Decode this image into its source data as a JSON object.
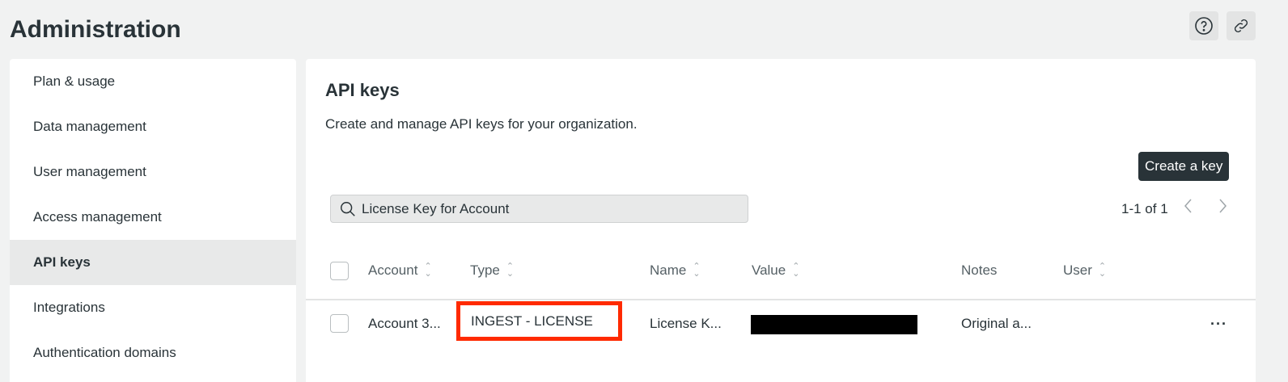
{
  "page_title": "Administration",
  "top_icons": [
    "help-icon",
    "link-icon"
  ],
  "sidebar": {
    "items": [
      {
        "label": "Plan & usage"
      },
      {
        "label": "Data management"
      },
      {
        "label": "User management"
      },
      {
        "label": "Access management"
      },
      {
        "label": "API keys",
        "active": true
      },
      {
        "label": "Integrations"
      },
      {
        "label": "Authentication domains"
      }
    ]
  },
  "main": {
    "title": "API keys",
    "description": "Create and manage API keys for your organization.",
    "create_button": "Create a key",
    "search_value": "License Key for Account",
    "pagination": "1-1 of 1",
    "columns": [
      "Account",
      "Type",
      "Name",
      "Value",
      "Notes",
      "User"
    ],
    "rows": [
      {
        "account": "Account 3...",
        "type": "INGEST - LICENSE",
        "name": "License K...",
        "value": "",
        "notes": "Original a...",
        "user": ""
      }
    ]
  },
  "colors": {
    "highlight": "#ff2a00",
    "primary_button": "#293338"
  }
}
